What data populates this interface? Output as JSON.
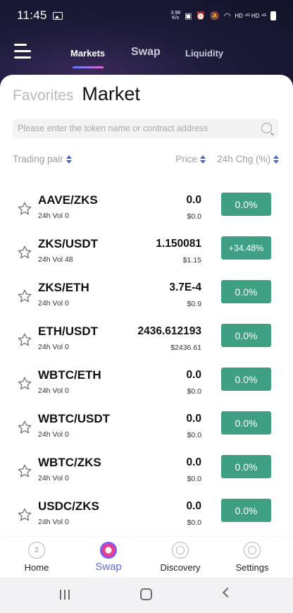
{
  "status_bar": {
    "time": "11:45",
    "speed_top": "3.98",
    "speed_bottom": "K/s",
    "network_labels": "HD ⁴ᴳ HD ⁴ᴳ"
  },
  "nav": {
    "tabs": [
      {
        "label": "Markets",
        "active": true
      },
      {
        "label": "Swap",
        "active": false
      },
      {
        "label": "Liquidity",
        "active": false
      }
    ]
  },
  "page": {
    "favorites_label": "Favorites",
    "market_label": "Market"
  },
  "search": {
    "placeholder": "Please enter the token name or contract address"
  },
  "columns": {
    "pair": "Trading pair",
    "price": "Price",
    "change": "24h Chg (%)"
  },
  "accent_color": "#3e9f83",
  "rows": [
    {
      "pair": "AAVE/ZKS",
      "vol": "24h Vol 0",
      "price": "0.0",
      "usd": "$0.0",
      "change": "0.0%"
    },
    {
      "pair": "ZKS/USDT",
      "vol": "24h Vol 48",
      "price": "1.150081",
      "usd": "$1.15",
      "change": "+34.48%"
    },
    {
      "pair": "ZKS/ETH",
      "vol": "24h Vol 0",
      "price": "3.7E-4",
      "usd": "$0.9",
      "change": "0.0%"
    },
    {
      "pair": "ETH/USDT",
      "vol": "24h Vol 0",
      "price": "2436.612193",
      "usd": "$2436.61",
      "change": "0.0%"
    },
    {
      "pair": "WBTC/ETH",
      "vol": "24h Vol 0",
      "price": "0.0",
      "usd": "$0.0",
      "change": "0.0%"
    },
    {
      "pair": "WBTC/USDT",
      "vol": "24h Vol 0",
      "price": "0.0",
      "usd": "$0.0",
      "change": "0.0%"
    },
    {
      "pair": "WBTC/ZKS",
      "vol": "24h Vol 0",
      "price": "0.0",
      "usd": "$0.0",
      "change": "0.0%"
    },
    {
      "pair": "USDC/ZKS",
      "vol": "24h Vol 0",
      "price": "0.0",
      "usd": "$0.0",
      "change": "0.0%"
    }
  ],
  "bottom_nav": [
    {
      "label": "Home",
      "icon": "home-icon",
      "active": false
    },
    {
      "label": "Swap",
      "icon": "swap-icon",
      "active": true
    },
    {
      "label": "Discovery",
      "icon": "discovery-icon",
      "active": false
    },
    {
      "label": "Settings",
      "icon": "settings-icon",
      "active": false
    }
  ]
}
